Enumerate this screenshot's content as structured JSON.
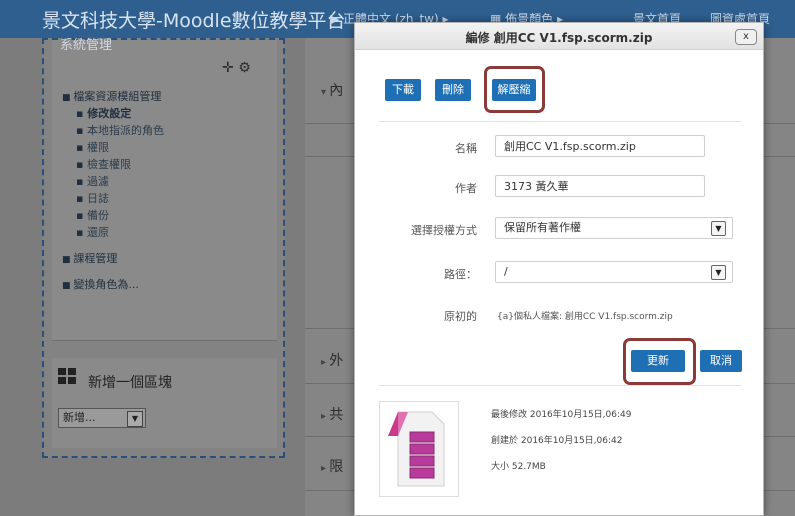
{
  "navbar": {
    "site_title": "景文科技大學-Moodle數位教學平台",
    "language": "正體中文 (zh_tw)",
    "theme_color": "佈景顏色",
    "home": "景文首頁",
    "resource_home": "圖資處首頁"
  },
  "admin_block": {
    "title": "系統管理",
    "items": [
      {
        "label": "檔案資源模組管理",
        "type": "folder"
      },
      {
        "label": "修改設定",
        "type": "file"
      },
      {
        "label": "本地指派的角色",
        "type": "file"
      },
      {
        "label": "權限",
        "type": "file"
      },
      {
        "label": "檢查權限",
        "type": "file"
      },
      {
        "label": "過濾",
        "type": "file"
      },
      {
        "label": "日誌",
        "type": "file"
      },
      {
        "label": "備份",
        "type": "file"
      },
      {
        "label": "還原",
        "type": "file"
      },
      {
        "label": "課程管理",
        "type": "folder"
      },
      {
        "label": "變換角色為...",
        "type": "folder"
      }
    ]
  },
  "add_block": {
    "title": "新增一個區塊",
    "select_value": "新增..."
  },
  "content": {
    "sections": [
      "內",
      "外",
      "共",
      "限"
    ]
  },
  "dialog": {
    "title": "編修 創用CC V1.fsp.scorm.zip",
    "close": "x",
    "buttons": {
      "download": "下載",
      "delete": "刪除",
      "unzip": "解壓縮",
      "update": "更新",
      "cancel": "取消"
    },
    "fields": {
      "name_label": "名稱",
      "name_value": "創用CC V1.fsp.scorm.zip",
      "author_label": "作者",
      "author_value": "3173 黃久華",
      "license_label": "選擇授權方式",
      "license_value": "保留所有著作權",
      "path_label": "路徑：",
      "path_value": "/",
      "original_label": "原初的",
      "original_value": "{a}個私人檔案: 創用CC V1.fsp.scorm.zip"
    },
    "meta": {
      "modified": "最後修改  2016年10月15日,06:49",
      "created": "創建於  2016年10月15日,06:42",
      "size": "大小  52.7MB"
    }
  }
}
